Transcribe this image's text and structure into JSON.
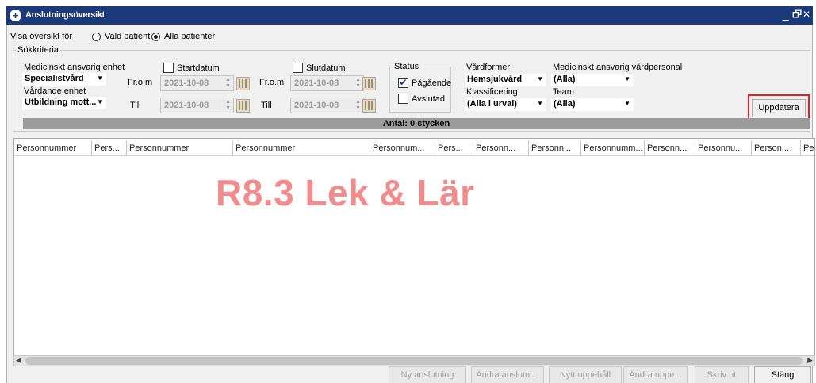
{
  "window": {
    "title": "Anslutningsöversikt",
    "minimize": "_",
    "restore": "🗗",
    "close": "✕"
  },
  "view": {
    "label": "Visa översikt för",
    "options": [
      "Vald patient",
      "Alla patienter"
    ],
    "selected": "Alla patienter"
  },
  "criteria": {
    "group_label": "Sökkriteria",
    "medical_unit_label": "Medicinskt ansvarig enhet",
    "medical_unit_value": "Specialistvård",
    "care_unit_label": "Vårdande enhet",
    "care_unit_value": "Utbildning mott...",
    "start": {
      "label": "Startdatum",
      "checked": false,
      "from_label": "Fr.o.m",
      "from_value": "2021-10-08",
      "to_label": "Till",
      "to_value": "2021-10-08"
    },
    "end": {
      "label": "Slutdatum",
      "checked": false,
      "from_label": "Fr.o.m",
      "from_value": "2021-10-08",
      "to_label": "Till",
      "to_value": "2021-10-08"
    },
    "status": {
      "label": "Status",
      "ongoing_label": "Pågående",
      "ongoing_checked": true,
      "finished_label": "Avslutad",
      "finished_checked": false
    },
    "care_forms_label": "Vårdformer",
    "care_forms_value": "Hemsjukvård",
    "classification_label": "Klassificering",
    "classification_value": "(Alla i urval)",
    "staff_label": "Medicinskt ansvarig vårdpersonal",
    "staff_value": "(Alla)",
    "team_label": "Team",
    "team_value": "(Alla)",
    "update_button": "Uppdatera"
  },
  "count_text": "Antal: 0 stycken",
  "table": {
    "columns": [
      "Personnummer",
      "Pers...",
      "Personnummer",
      "Personnummer",
      "Personnum...",
      "Pers...",
      "Personn...",
      "Personn...",
      "Personnumm...",
      "Personn...",
      "Personnu...",
      "Person...",
      "Per"
    ],
    "rows": []
  },
  "watermark": "R8.3 Lek & Lär",
  "footer_buttons": [
    "Ny anslutning",
    "Ändra anslutni...",
    "Nytt uppehåll",
    "Ändra uppe...",
    "Skriv ut",
    "Stäng"
  ],
  "colors": {
    "titlebar": "#1a3a7c",
    "watermark": "#f28c8c",
    "highlight": "#e02020"
  }
}
